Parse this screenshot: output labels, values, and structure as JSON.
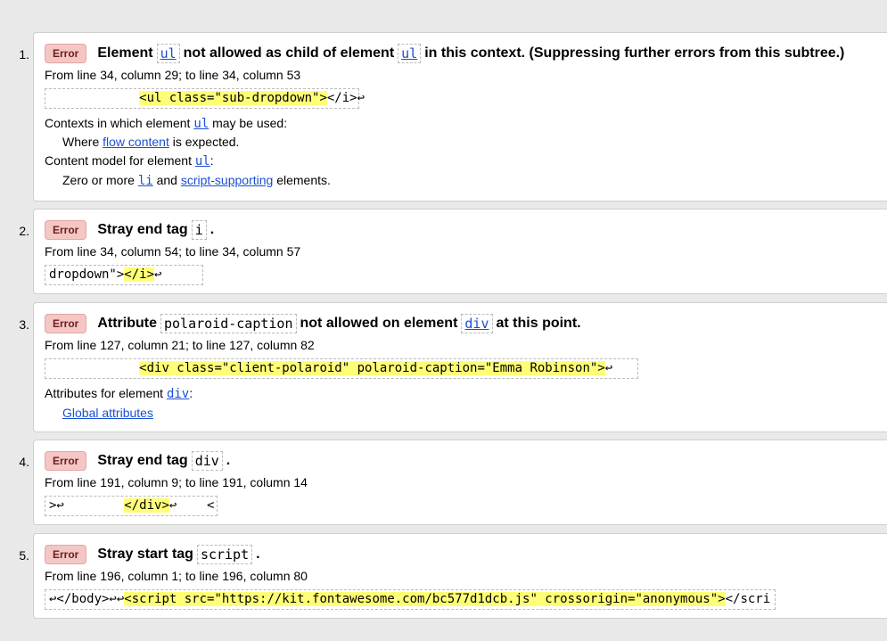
{
  "messages": [
    {
      "number": "1.",
      "badge": "Error",
      "msg_a": "Element",
      "code_a": "ul",
      "msg_b": "not allowed as child of element",
      "code_b": "ul",
      "msg_c": "in this context. (Suppressing further errors from this subtree.)",
      "location": "From line 34, column 29; to line 34, column 53",
      "extract_pre": "            ",
      "extract_hl": "<ul class=\"sub-dropdown\">",
      "extract_post": "</i>↩",
      "ctx_label_a": "Contexts in which element",
      "ctx_code": "ul",
      "ctx_label_b": "may be used:",
      "ctx_where_a": "Where",
      "ctx_where_link": "flow content",
      "ctx_where_b": "is expected.",
      "cm_label_a": "Content model for element",
      "cm_code": "ul",
      "cm_label_b": ":",
      "cm_a": "Zero or more",
      "cm_code2": "li",
      "cm_b": "and",
      "cm_link": "script-supporting",
      "cm_c": "elements."
    },
    {
      "number": "2.",
      "badge": "Error",
      "msg_a": "Stray end tag",
      "code_a": "i",
      "msg_b": ".",
      "location": "From line 34, column 54; to line 34, column 57",
      "extract_pre": "dropdown\">",
      "extract_hl": "</i>",
      "extract_post": "↩      "
    },
    {
      "number": "3.",
      "badge": "Error",
      "msg_a": "Attribute",
      "code_a": "polaroid-caption",
      "msg_b": "not allowed on element",
      "code_b": "div",
      "msg_c": "at this point.",
      "location": "From line 127, column 21; to line 127, column 82",
      "extract_pre": "            ",
      "extract_hl": "<div class=\"client-polaroid\" polaroid-caption=\"Emma Robinson\">",
      "extract_post": "↩        ",
      "attr_label_a": "Attributes for element",
      "attr_code": "div",
      "attr_label_b": ":",
      "attr_link": "Global attributes"
    },
    {
      "number": "4.",
      "badge": "Error",
      "msg_a": "Stray end tag",
      "code_a": "div",
      "msg_b": ".",
      "location": "From line 191, column 9; to line 191, column 14",
      "extract_pre": ">↩        ",
      "extract_hl": "</div>",
      "extract_post": "↩    <"
    },
    {
      "number": "5.",
      "badge": "Error",
      "msg_a": "Stray start tag",
      "code_a": "script",
      "msg_b": ".",
      "location": "From line 196, column 1; to line 196, column 80",
      "extract_pre": "↩</body>↩↩",
      "extract_hl": "<script src=\"https://kit.fontawesome.com/bc577d1dcb.js\" crossorigin=\"anonymous\">",
      "extract_post": "</scri"
    }
  ]
}
